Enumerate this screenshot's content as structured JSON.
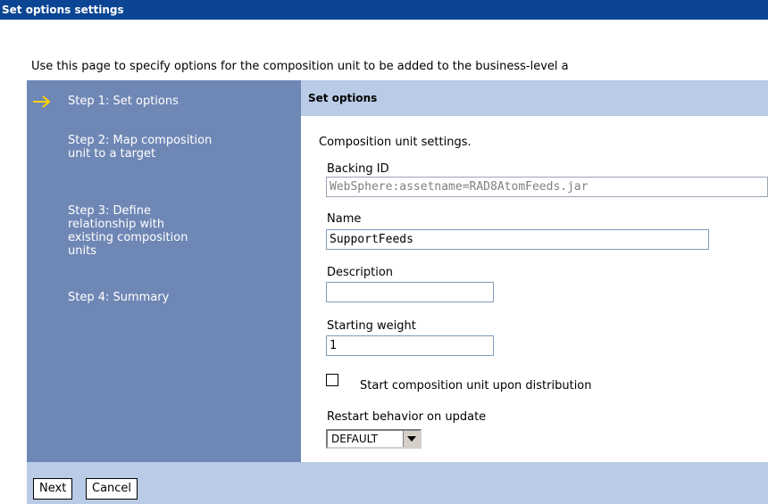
{
  "window": {
    "title": "Set options settings"
  },
  "intro_text": "Use this page to specify options for the composition unit to be added to the business-level a",
  "steps": [
    {
      "label": "Step 1: Set options",
      "active": true
    },
    {
      "label": "Step 2: Map composition unit to a target",
      "active": false
    },
    {
      "label": "Step 3: Define relationship with existing composition units",
      "active": false
    },
    {
      "label": "Step 4: Summary",
      "active": false
    }
  ],
  "panel": {
    "header": "Set options",
    "subtitle": "Composition unit settings.",
    "backing_id": {
      "label": "Backing ID",
      "value": "WebSphere:assetname=RAD8AtomFeeds.jar"
    },
    "name": {
      "label": "Name",
      "value": "SupportFeeds"
    },
    "description": {
      "label": "Description",
      "value": ""
    },
    "starting_weight": {
      "label": "Starting weight",
      "value": "1"
    },
    "start_on_distribution": {
      "label": "Start composition unit upon distribution",
      "checked": false
    },
    "restart_behavior": {
      "label": "Restart behavior on update",
      "selected": "DEFAULT"
    }
  },
  "footer": {
    "next_label": "Next",
    "cancel_label": "Cancel"
  },
  "colors": {
    "titlebar": "#0b4593",
    "steps_bg": "#6f87b5",
    "header_bg": "#b9cbe6",
    "arrow": "#ffd200"
  },
  "icons": {
    "current_step": "arrow-right-icon",
    "dropdown": "triangle-down-icon"
  }
}
